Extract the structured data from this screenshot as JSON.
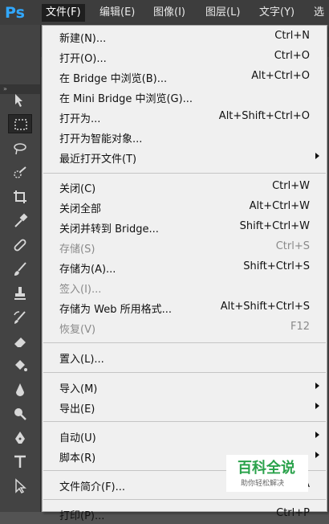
{
  "app": {
    "logo": "Ps"
  },
  "menubar": {
    "items": [
      {
        "label": "文件(F)",
        "active": true
      },
      {
        "label": "编辑(E)"
      },
      {
        "label": "图像(I)"
      },
      {
        "label": "图层(L)"
      },
      {
        "label": "文字(Y)"
      },
      {
        "label": "选"
      }
    ]
  },
  "toolbar": {
    "collapse_label": "»"
  },
  "file_menu": {
    "items": [
      {
        "label": "新建(N)...",
        "shortcut": "Ctrl+N"
      },
      {
        "label": "打开(O)...",
        "shortcut": "Ctrl+O"
      },
      {
        "label": "在 Bridge 中浏览(B)...",
        "shortcut": "Alt+Ctrl+O"
      },
      {
        "label": "在 Mini Bridge 中浏览(G)...",
        "shortcut": ""
      },
      {
        "label": "打开为...",
        "shortcut": "Alt+Shift+Ctrl+O"
      },
      {
        "label": "打开为智能对象...",
        "shortcut": ""
      },
      {
        "label": "最近打开文件(T)",
        "shortcut": "",
        "submenu": true
      },
      {
        "label": "关闭(C)",
        "shortcut": "Ctrl+W"
      },
      {
        "label": "关闭全部",
        "shortcut": "Alt+Ctrl+W"
      },
      {
        "label": "关闭并转到 Bridge...",
        "shortcut": "Shift+Ctrl+W"
      },
      {
        "label": "存储(S)",
        "shortcut": "Ctrl+S",
        "disabled": true
      },
      {
        "label": "存储为(A)...",
        "shortcut": "Shift+Ctrl+S"
      },
      {
        "label": "签入(I)...",
        "shortcut": "",
        "disabled": true
      },
      {
        "label": "存储为 Web 所用格式...",
        "shortcut": "Alt+Shift+Ctrl+S"
      },
      {
        "label": "恢复(V)",
        "shortcut": "F12",
        "disabled": true
      },
      {
        "label": "置入(L)...",
        "shortcut": ""
      },
      {
        "label": "导入(M)",
        "shortcut": "",
        "submenu": true
      },
      {
        "label": "导出(E)",
        "shortcut": "",
        "submenu": true
      },
      {
        "label": "自动(U)",
        "shortcut": "",
        "submenu": true
      },
      {
        "label": "脚本(R)",
        "shortcut": "",
        "submenu": true
      },
      {
        "label": "文件简介(F)...",
        "shortcut": "A"
      },
      {
        "label": "打印(P)...",
        "shortcut": "Ctrl+P"
      }
    ]
  },
  "watermark": {
    "title": "百科全说",
    "subtitle": "助你轻松解决"
  },
  "colors": {
    "menubar_bg": "#3d3d3d",
    "menu_bg": "#f0f0f0",
    "toolbar_bg": "#434343",
    "ps_blue": "#31a8ff",
    "watermark_green": "#2aa24b"
  }
}
